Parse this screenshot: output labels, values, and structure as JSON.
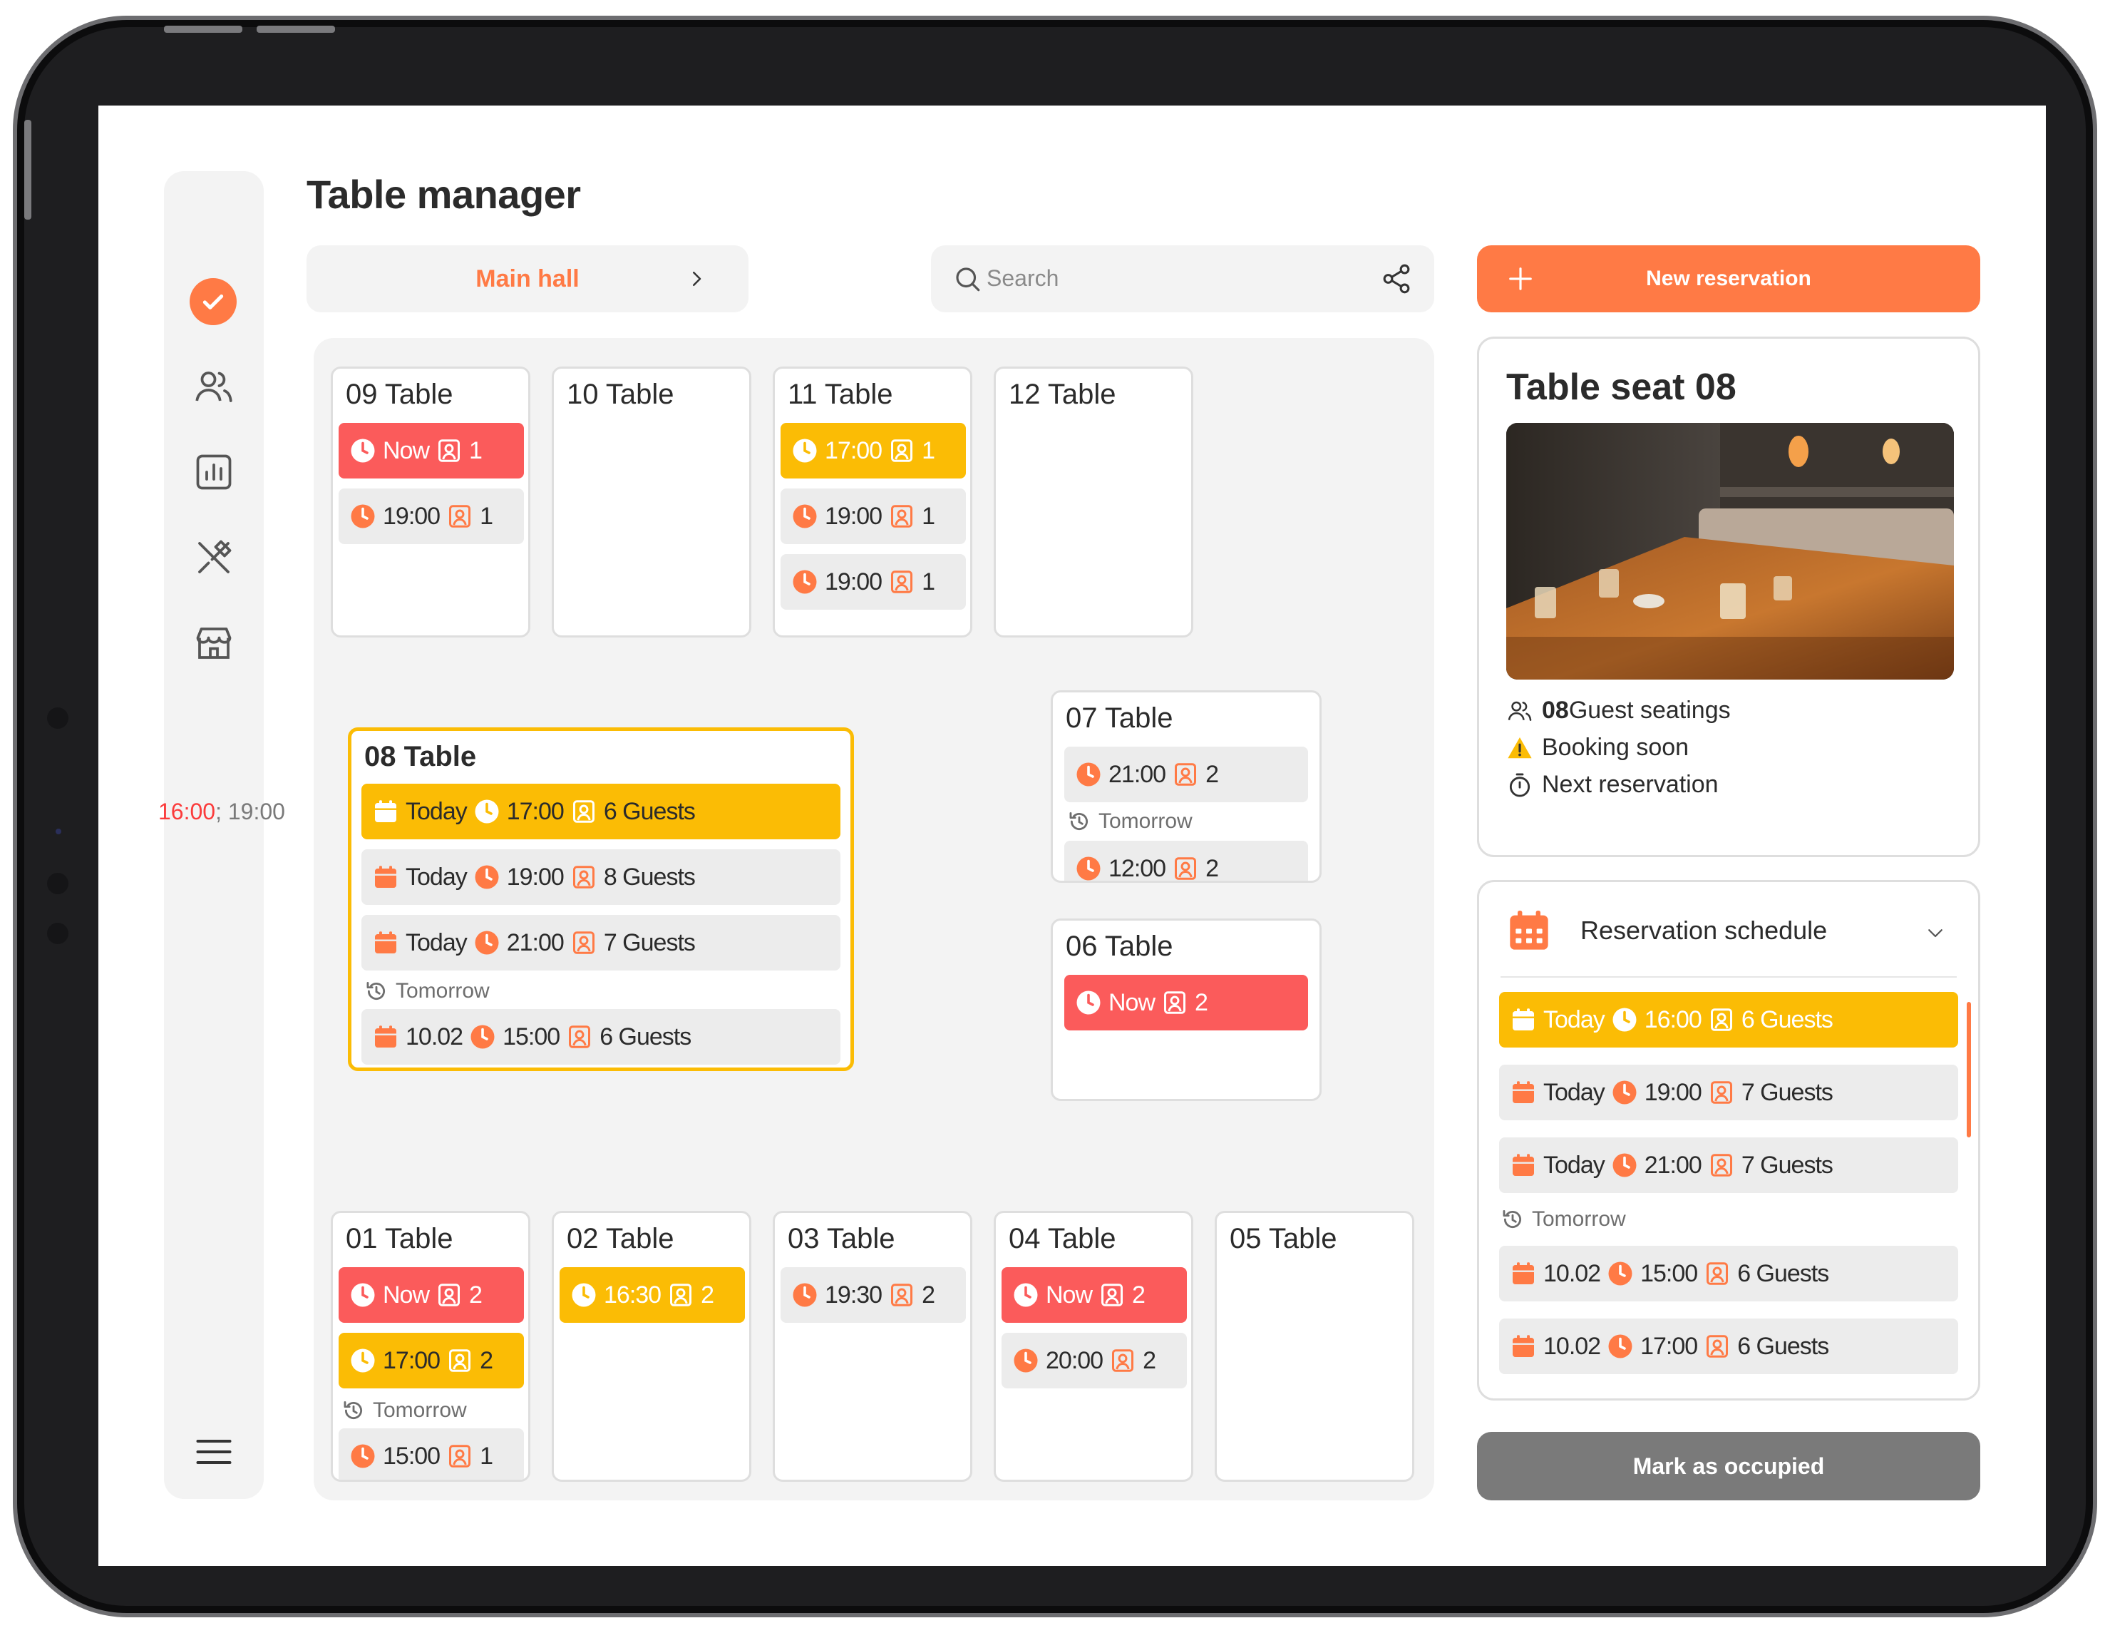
{
  "page": {
    "title": "Table manager"
  },
  "hall": {
    "label": "Main hall"
  },
  "search": {
    "placeholder": "Search"
  },
  "new_reservation": {
    "label": "New reservation"
  },
  "tomorrow_label": "Tomorrow",
  "colors": {
    "accent": "#ff7a45",
    "now": "#fb5b5b",
    "soon": "#fbbc05",
    "neutral": "#ececec"
  },
  "tables": {
    "t09": {
      "title": "09 Table",
      "r": [
        {
          "time": "Now",
          "guests": "1"
        },
        {
          "time": "19:00",
          "guests": "1"
        }
      ]
    },
    "t10": {
      "title": "10 Table"
    },
    "t11": {
      "title": "11 Table",
      "r": [
        {
          "time": "17:00",
          "guests": "1"
        },
        {
          "time": "19:00",
          "guests": "1"
        },
        {
          "time": "19:00",
          "guests": "1"
        }
      ]
    },
    "t12": {
      "title": "12 Table"
    },
    "t08": {
      "title": "08 Table",
      "r": [
        {
          "day": "Today",
          "time": "17:00",
          "guests": "6 Guests"
        },
        {
          "day": "Today",
          "time": "19:00",
          "guests": "8 Guests"
        },
        {
          "day": "Today",
          "time": "21:00",
          "guests": "7 Guests"
        },
        {
          "day": "10.02",
          "time": "15:00",
          "guests": "6 Guests"
        }
      ]
    },
    "t07": {
      "title": "07 Table",
      "r": [
        {
          "time": "21:00",
          "guests": "2"
        },
        {
          "time": "12:00",
          "guests": "2"
        }
      ]
    },
    "t06": {
      "title": "06 Table",
      "r": [
        {
          "time": "Now",
          "guests": "2"
        }
      ]
    },
    "t01": {
      "title": "01 Table",
      "r": [
        {
          "time": "Now",
          "guests": "2"
        },
        {
          "time": "17:00",
          "guests": "2"
        },
        {
          "time": "15:00",
          "guests": "1"
        }
      ]
    },
    "t02": {
      "title": "02 Table",
      "r": [
        {
          "time": "16:30",
          "guests": "2"
        }
      ]
    },
    "t03": {
      "title": "03 Table",
      "r": [
        {
          "time": "19:30",
          "guests": "2"
        }
      ]
    },
    "t04": {
      "title": "04 Table",
      "r": [
        {
          "time": "Now",
          "guests": "2"
        },
        {
          "time": "20:00",
          "guests": "2"
        }
      ]
    },
    "t05": {
      "title": "05 Table"
    }
  },
  "seat": {
    "title": "Table seat 08",
    "guest_count": "08",
    "guest_label": "Guest seatings",
    "status": "Booking soon",
    "next_label": "Next reservation",
    "next_time": "16:00",
    "sep": ";",
    "after_time": "19:00"
  },
  "schedule": {
    "title": "Reservation schedule",
    "items": [
      {
        "day": "Today",
        "time": "16:00",
        "guests": "6 Guests"
      },
      {
        "day": "Today",
        "time": "19:00",
        "guests": "7 Guests"
      },
      {
        "day": "Today",
        "time": "21:00",
        "guests": "7 Guests"
      },
      {
        "day": "10.02",
        "time": "15:00",
        "guests": "6 Guests"
      },
      {
        "day": "10.02",
        "time": "17:00",
        "guests": "6 Guests"
      }
    ]
  },
  "mark_occupied": {
    "label": "Mark as occupied"
  }
}
